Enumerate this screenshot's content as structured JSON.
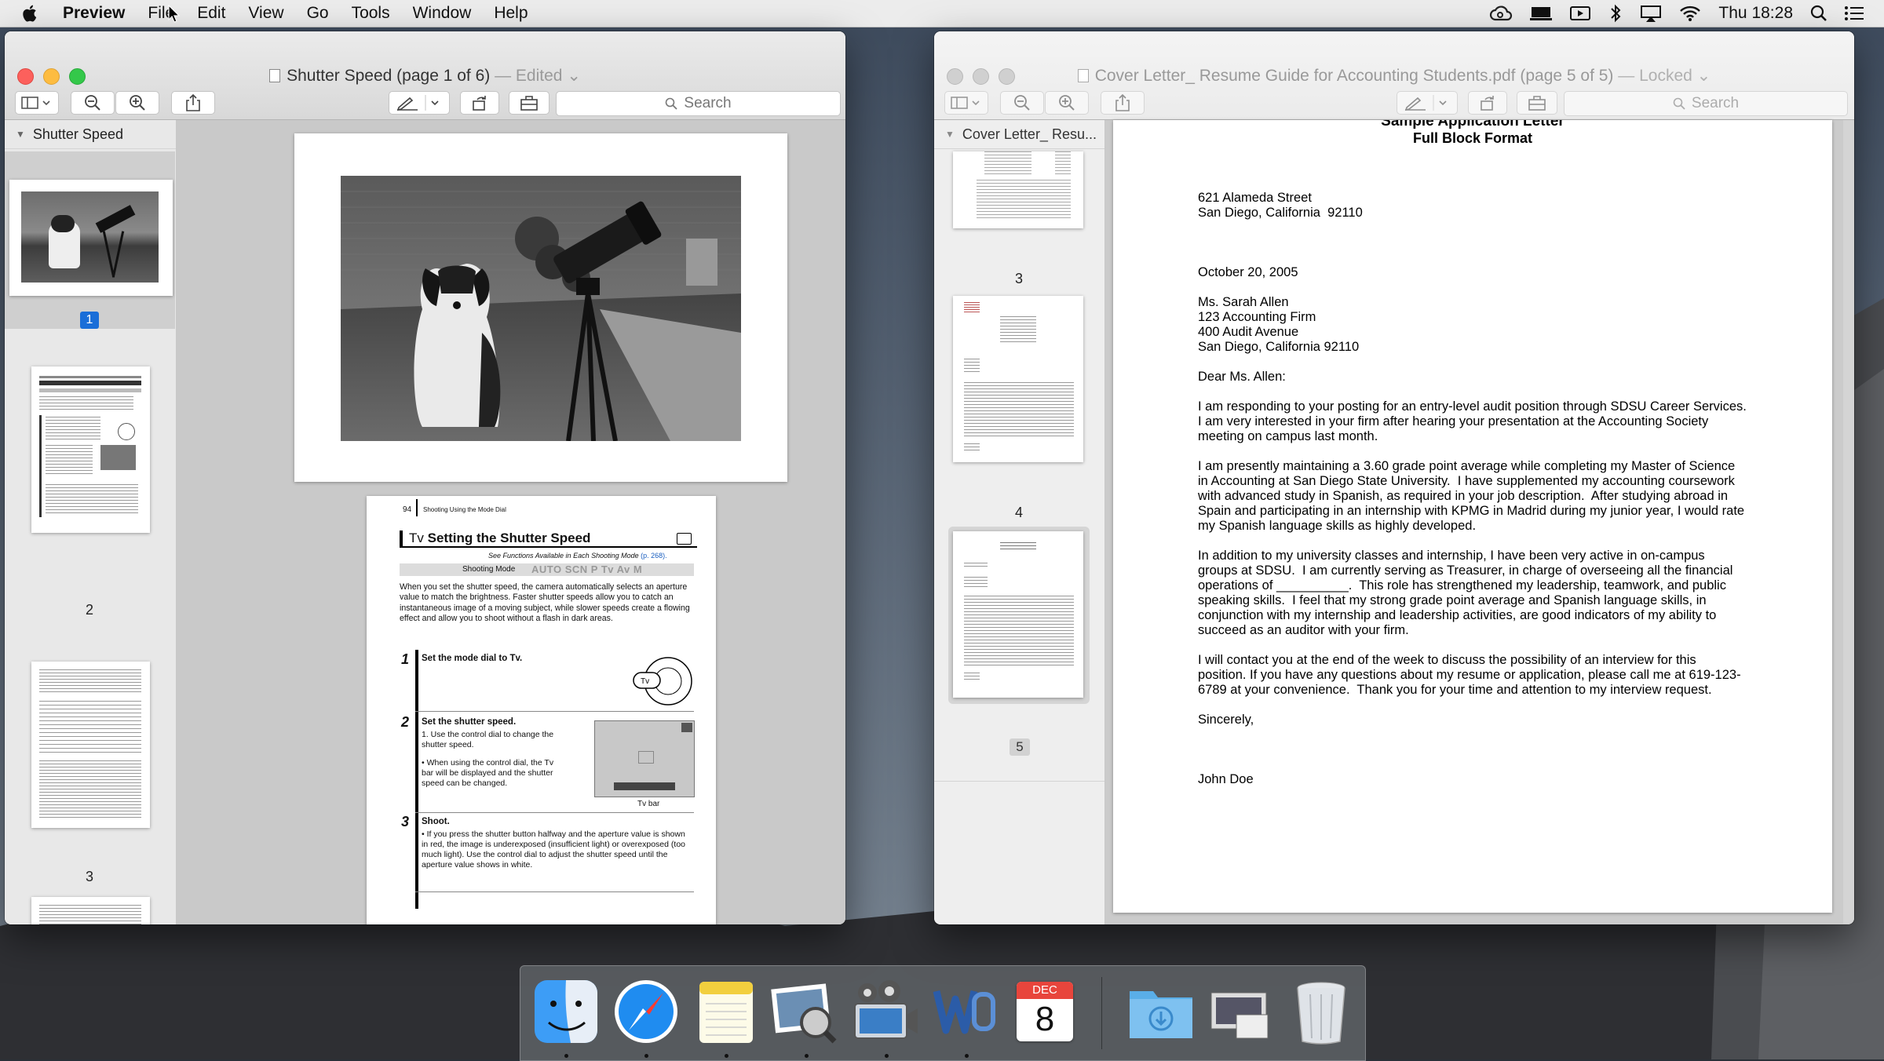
{
  "menubar": {
    "app": "Preview",
    "items": [
      "File",
      "Edit",
      "View",
      "Go",
      "Tools",
      "Window",
      "Help"
    ],
    "clock": "Thu 18:28"
  },
  "left_window": {
    "title": "Shutter Speed (page 1 of 6)",
    "status": "— Edited",
    "search_placeholder": "Search",
    "sidebar_title": "Shutter Speed",
    "thumbs": [
      "1",
      "2",
      "3"
    ],
    "manual": {
      "page_no": "94",
      "section": "Shooting Using the Mode Dial",
      "heading_mode": "Tv",
      "heading": "Setting the Shutter Speed",
      "see_note": "See Functions Available in Each Shooting Mode",
      "see_link": "(p. 268).",
      "shooting_mode_label": "Shooting Mode",
      "modes": "AUTO SCN P Tv Av M",
      "intro": "When you set the shutter speed, the camera automatically selects an aperture value to match the brightness. Faster shutter speeds allow you to catch an instantaneous image of a moving subject, while slower speeds create a flowing effect and allow you to shoot without a flash in dark areas.",
      "step1_title": "Set the mode dial to Tv.",
      "step2_title": "Set the shutter speed.",
      "step2_a": "1. Use the control dial to change the shutter speed.",
      "step2_b": "• When using the control dial, the Tv bar will be displayed and the shutter speed can be changed.",
      "tv_bar": "Tv bar",
      "step3_title": "Shoot.",
      "step3_text": "• If you press the shutter button halfway and the aperture value is shown in red, the image is underexposed (insufficient light) or overexposed (too much light). Use the control dial to adjust the shutter speed until the aperture value shows in white."
    }
  },
  "right_window": {
    "title": "Cover Letter_ Resume Guide for Accounting Students.pdf (page 5 of 5)",
    "status": "— Locked",
    "search_placeholder": "Search",
    "sidebar_title": "Cover Letter_ Resu...",
    "thumbs": [
      "3",
      "4",
      "5"
    ],
    "letter": {
      "heading": "Sample Application Letter",
      "subheading": "Full Block Format",
      "addr1": "621 Alameda Street",
      "addr2": "San Diego, California  92110",
      "date": "October 20, 2005",
      "r1": "Ms. Sarah Allen",
      "r2": "123 Accounting Firm",
      "r3": "400 Audit Avenue",
      "r4": "San Diego, California 92110",
      "salutation": "Dear Ms. Allen:",
      "p1": "I am responding to your posting for an entry-level audit position through SDSU Career Services. I am very interested in your firm after hearing your presentation at the Accounting Society meeting on campus last month.",
      "p2": "I am presently maintaining a 3.60 grade point average while completing my Master of Science in Accounting at San Diego State University.  I have supplemented my accounting coursework with advanced study in Spanish, as required in your job description.  After studying abroad in Spain and participating in an internship with KPMG in Madrid during my junior year, I would rate my Spanish language skills as highly developed.",
      "p3": "In addition to my university classes and internship, I have been very active in on-campus groups at SDSU.  I am currently serving as Treasurer, in charge of overseeing all the financial operations of __________.  This role has strengthened my leadership, teamwork, and public speaking skills.  I feel that my strong grade point average and Spanish language skills, in conjunction with my internship and leadership activities, are good indicators of my ability to succeed as an auditor with your firm.",
      "p4": "I will contact you at the end of the week to discuss the possibility of an interview for this position. If you have any questions about my resume or application, please call me at 619-123-6789 at your convenience.  Thank you for your time and attention to my interview request.",
      "closing": "Sincerely,",
      "name": "John Doe"
    }
  },
  "dock": {
    "calendar_month": "DEC",
    "calendar_day": "8"
  },
  "colors": {
    "close": "#fc605c",
    "minimize": "#fdbc40",
    "zoom": "#34c84a",
    "inactive_light": "#d0d0d0",
    "selection": "#1a6ed8"
  }
}
